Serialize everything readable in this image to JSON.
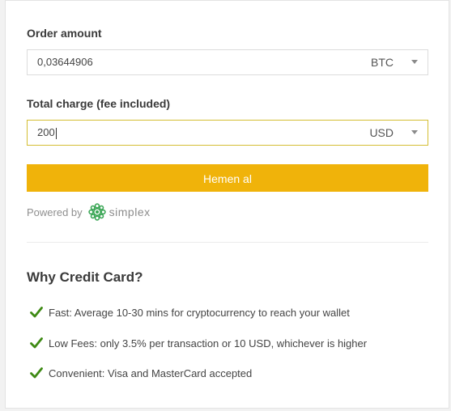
{
  "order": {
    "label": "Order amount",
    "amount_value": "0,03644906",
    "currency": "BTC"
  },
  "total": {
    "label": "Total charge (fee included)",
    "charge_value": "200",
    "currency": "USD"
  },
  "buy_button": {
    "label": "Hemen al"
  },
  "powered": {
    "prefix": "Powered by",
    "brand": "simplex",
    "logo_icon": "simplex-logo-icon"
  },
  "why": {
    "title": "Why Credit Card?",
    "items": [
      {
        "icon": "checkmark-icon",
        "text": "Fast: Average 10-30 mins for cryptocurrency to reach your wallet"
      },
      {
        "icon": "checkmark-icon",
        "text": "Low Fees: only 3.5% per transaction or 10 USD, whichever is higher"
      },
      {
        "icon": "checkmark-icon",
        "text": "Convenient: Visa and MasterCard accepted"
      }
    ]
  },
  "colors": {
    "accent": "#f0b30a",
    "check_green": "#3e8a14",
    "logo_green": "#3aa655",
    "active_border": "#d4be33"
  }
}
